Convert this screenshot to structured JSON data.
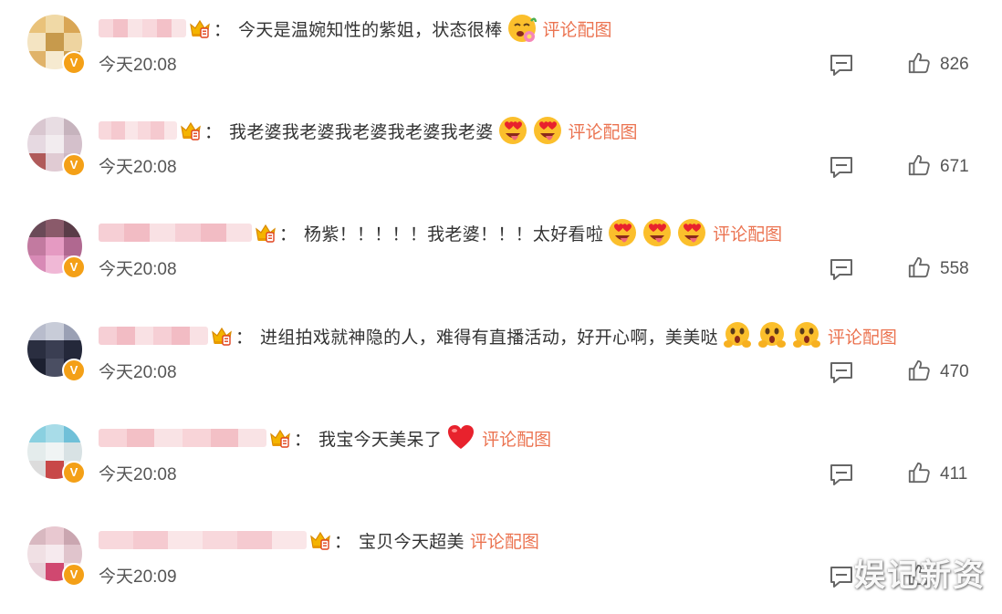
{
  "comments": [
    {
      "username": "",
      "text": "今天是温婉知性的紫姐，状态很棒",
      "emoji": [
        "flower-face"
      ],
      "pic_link": "评论配图",
      "time": "今天20:08",
      "likes": "826",
      "avatar_colors": [
        "#e9c27a",
        "#f0d9a6",
        "#d9a655",
        "#f4e4c2",
        "#c79a4c",
        "#eed4a0",
        "#e0b36a",
        "#f6ead0",
        "#cfa050"
      ],
      "username_colors": [
        "#f8d8dc",
        "#f3c1c8",
        "#f9e4e6"
      ]
    },
    {
      "username": "",
      "text": "我老婆我老婆我老婆我老婆我老婆",
      "emoji": [
        "heart-eyes",
        "heart-eyes"
      ],
      "pic_link": "评论配图",
      "time": "今天20:08",
      "likes": "671",
      "avatar_colors": [
        "#d9c7d0",
        "#e8dde3",
        "#c6b3bd",
        "#e6d9e1",
        "#f2ecef",
        "#d4c0cb",
        "#b05a5a",
        "#e0cbd3",
        "#cdb7c2"
      ],
      "username_colors": [
        "#f8d8dc",
        "#f5c9cf",
        "#fae6e8"
      ]
    },
    {
      "username": "",
      "text": "杨紫！！！！！我老婆！！！太好看啦",
      "emoji": [
        "heart-eyes",
        "heart-eyes",
        "heart-eyes"
      ],
      "pic_link": "评论配图",
      "time": "今天20:08",
      "likes": "558",
      "avatar_colors": [
        "#6a4a58",
        "#8a5a6a",
        "#5a3c48",
        "#c27aa0",
        "#e59ac2",
        "#b06890",
        "#d88ab6",
        "#f0b8d6",
        "#c880a8"
      ],
      "username_colors": [
        "#f6cfd5",
        "#f2bcc4",
        "#f9e1e4"
      ]
    },
    {
      "username": "",
      "text": "进组拍戏就神隐的人，难得有直播活动，好开心啊，美美哒",
      "emoji": [
        "hug-face",
        "hug-face",
        "hug-face"
      ],
      "pic_link": "评论配图",
      "time": "今天20:08",
      "likes": "470",
      "avatar_colors": [
        "#b8bccc",
        "#c8ccd8",
        "#9aa0b4",
        "#2a2e40",
        "#3a3e52",
        "#24283a",
        "#1c2030",
        "#4a4e62",
        "#20243a"
      ],
      "username_colors": [
        "#f6cfd5",
        "#f2bcc4",
        "#f9e1e4"
      ]
    },
    {
      "username": "",
      "text": "我宝今天美呆了",
      "emoji": [
        "red-heart"
      ],
      "pic_link": "评论配图",
      "time": "今天20:08",
      "likes": "411",
      "avatar_colors": [
        "#8ad0e0",
        "#a8dce8",
        "#70c0d8",
        "#e4ecec",
        "#f0f4f4",
        "#d8e2e4",
        "#dcdcdc",
        "#c84848",
        "#e8e8e8"
      ],
      "username_colors": [
        "#f8d4d8",
        "#f3c0c6",
        "#f9e3e5"
      ]
    },
    {
      "username": "",
      "text": "宝贝今天超美",
      "emoji": [],
      "pic_link": "评论配图",
      "time": "今天20:09",
      "likes": "",
      "avatar_colors": [
        "#d8b8c0",
        "#e8c8d0",
        "#caa6b0",
        "#f0e0e4",
        "#f6eaee",
        "#e0c4cc",
        "#e8d0d8",
        "#d04870",
        "#efdce2"
      ],
      "username_colors": [
        "#f8d8dc",
        "#f5cad0",
        "#fae6e8"
      ]
    }
  ],
  "watermark": "娱记新资",
  "colors": {
    "link": "#eb7350",
    "badge": "#f4a017",
    "text": "#333333",
    "muted": "#555555"
  },
  "icons": {
    "verified": "verified-v-badge",
    "crown": "vip-crown-icon",
    "reply": "comment-reply-icon",
    "like": "thumbs-up-icon"
  }
}
